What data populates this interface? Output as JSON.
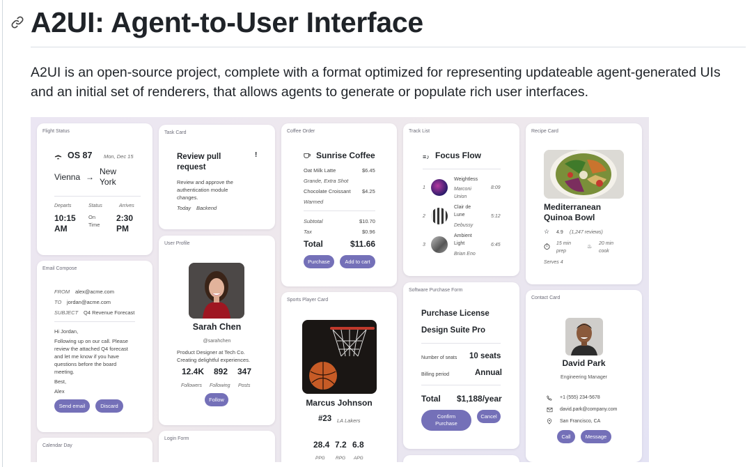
{
  "page": {
    "title": "A2UI: Agent-to-User Interface",
    "intro": "A2UI is an open-source project, complete with a format optimized for representing updateable agent-generated UIs and an initial set of renderers, that allows agents to generate or populate rich user interfaces."
  },
  "colors": {
    "accent": "#7470b8",
    "background": "#ebe6f3"
  },
  "cards": {
    "flight": {
      "label": "Flight Status",
      "flight": "OS 87",
      "date": "Mon, Dec 15",
      "from": "Vienna",
      "arrow": "→",
      "to_line1": "New",
      "to_line2": "York",
      "departs_label": "Departs",
      "status_label": "Status",
      "arrives_label": "Arrives",
      "departs_l1": "10:15",
      "departs_l2": "AM",
      "status_l1": "On",
      "status_l2": "Time",
      "arrives_l1": "2:30",
      "arrives_l2": "PM"
    },
    "task": {
      "label": "Task Card",
      "title_l1": "Review pull",
      "title_l2": "request",
      "priority": "!",
      "desc_l1": "Review and approve the",
      "desc_l2": "authentication module",
      "desc_l3": "changes.",
      "due": "Today",
      "tag": "Backend"
    },
    "coffee": {
      "label": "Coffee Order",
      "name": "Sunrise Coffee",
      "item1": "Oat Milk Latte",
      "item1_price": "$6.45",
      "item1_note": "Grande, Extra Shot",
      "item2": "Chocolate Croissant",
      "item2_price": "$4.25",
      "item2_note": "Warmed",
      "subtotal_label": "Subtotal",
      "subtotal": "$10.70",
      "tax_label": "Tax",
      "tax": "$0.96",
      "total_label": "Total",
      "total": "$11.66",
      "purchase": "Purchase",
      "add_cart": "Add to cart"
    },
    "tracks": {
      "label": "Track List",
      "title": "Focus Flow",
      "items": [
        {
          "num": "1",
          "title": "Weightless",
          "artist_l1": "Marconi",
          "artist_l2": "Union",
          "time": "8:09"
        },
        {
          "num": "2",
          "title_l1": "Clair de",
          "title_l2": "Lune",
          "artist": "Debussy",
          "time": "5:12"
        },
        {
          "num": "3",
          "title_l1": "Ambient",
          "title_l2": "Light",
          "artist": "Brian Eno",
          "time": "6:45"
        }
      ]
    },
    "recipe": {
      "label": "Recipe Card",
      "title_l1": "Mediterranean",
      "title_l2": "Quinoa Bowl",
      "rating": "4.9",
      "reviews": "(1,247 reviews)",
      "prep_l1": "15 min",
      "prep_l2": "prep",
      "cook_l1": "20 min",
      "cook_l2": "cook",
      "serves": "Serves 4"
    },
    "email": {
      "label": "Email Compose",
      "from_label": "FROM",
      "from": "alex@acme.com",
      "to_label": "TO",
      "to": "jordan@acme.com",
      "subject_label": "SUBJECT",
      "subject": "Q4 Revenue Forecast",
      "greeting": "Hi Jordan,",
      "body_l1": "Following up on our call. Please",
      "body_l2": "review the attached Q4 forecast",
      "body_l3": "and let me know if you have",
      "body_l4": "questions before the board",
      "body_l5": "meeting.",
      "signoff": "Best,",
      "signature": "Alex",
      "send": "Send email",
      "discard": "Discard"
    },
    "profile": {
      "label": "User Profile",
      "name": "Sarah Chen",
      "handle": "@sarahchen",
      "bio_l1": "Product Designer at Tech Co.",
      "bio_l2": "Creating delightful experiences.",
      "followers": "12.4K",
      "following": "892",
      "posts": "347",
      "followers_label": "Followers",
      "following_label": "Following",
      "posts_label": "Posts",
      "follow": "Follow"
    },
    "sports": {
      "label": "Sports Player Card",
      "name": "Marcus Johnson",
      "number": "#23",
      "team": "LA Lakers",
      "ppg": "28.4",
      "rpg": "7.2",
      "apg": "6.8",
      "ppg_label": "PPG",
      "rpg_label": "RPG",
      "apg_label": "APG"
    },
    "purchase": {
      "label": "Software Purchase Form",
      "title_l1": "Purchase License",
      "title_l2": "Design Suite Pro",
      "seats_label": "Number of seats",
      "seats": "10 seats",
      "period_label": "Billing period",
      "period": "Annual",
      "total_label": "Total",
      "total": "$1,188/year",
      "confirm_l1": "Confirm",
      "confirm_l2": "Purchase",
      "cancel": "Cancel"
    },
    "contact": {
      "label": "Contact Card",
      "name": "David Park",
      "role": "Engineering Manager",
      "phone": "+1 (555) 234-5678",
      "email": "david.park@company.com",
      "location": "San Francisco, CA",
      "call": "Call",
      "message": "Message"
    },
    "calendar": {
      "label": "Calendar Day"
    },
    "login": {
      "label": "Login Form"
    }
  }
}
